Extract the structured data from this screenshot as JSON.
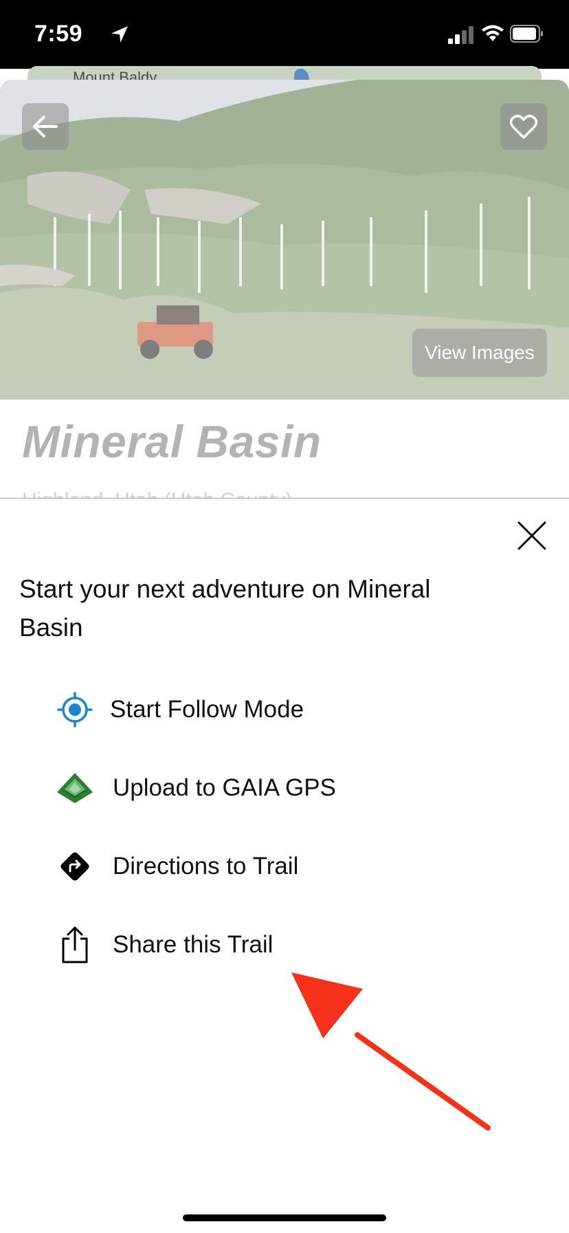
{
  "status_bar": {
    "time": "7:59"
  },
  "map": {
    "label": "Mount Baldy"
  },
  "hero": {
    "view_images_label": "View Images"
  },
  "trail": {
    "name": "Mineral Basin",
    "location": "Highland, Utah (Utah County)"
  },
  "sheet": {
    "heading": "Start your next adventure on Mineral Basin",
    "actions": [
      {
        "label": "Start Follow Mode",
        "icon": "follow-mode-target-icon",
        "color": "#1a86d0"
      },
      {
        "label": "Upload to GAIA GPS",
        "icon": "gaia-gps-logo-icon",
        "color": "#3d9b3d"
      },
      {
        "label": "Directions to Trail",
        "icon": "directions-icon",
        "color": "#000000"
      },
      {
        "label": "Share this Trail",
        "icon": "share-icon",
        "color": "#000000"
      }
    ]
  },
  "annotation": {
    "arrow_color": "#f5311a"
  }
}
